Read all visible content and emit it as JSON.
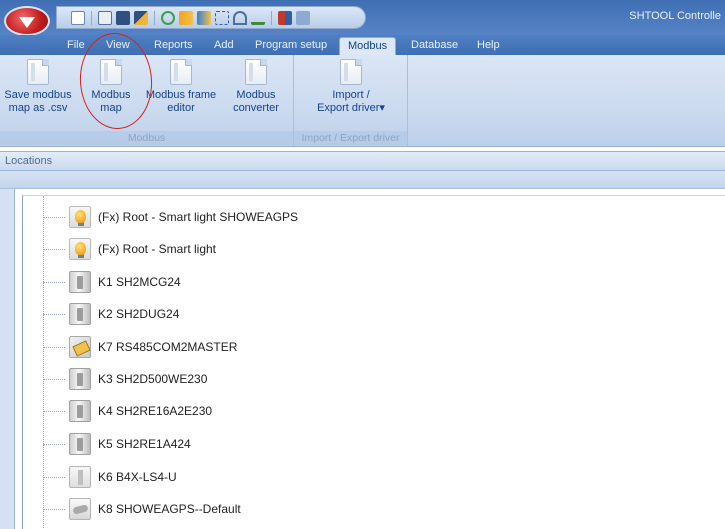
{
  "window": {
    "title": "SHTOOL Controlle"
  },
  "quick_access": {
    "icons": [
      "new-file-icon",
      "open-file-icon",
      "save-icon",
      "edit-icon",
      "refresh-icon",
      "import-icon",
      "export-icon",
      "network-icon",
      "antenna-icon",
      "hierarchy-icon",
      "module-icon",
      "list-icon"
    ]
  },
  "menu": {
    "tabs": [
      {
        "label": "File"
      },
      {
        "label": "View"
      },
      {
        "label": "Reports"
      },
      {
        "label": "Add"
      },
      {
        "label": "Program setup"
      },
      {
        "label": "Modbus",
        "active": true
      },
      {
        "label": "Database"
      },
      {
        "label": "Help"
      }
    ]
  },
  "ribbon": {
    "groups": [
      {
        "label": "Modbus",
        "buttons": [
          {
            "line1": "Save modbus",
            "line2": "map as .csv"
          },
          {
            "line1": "Modbus",
            "line2": "map"
          },
          {
            "line1": "Modbus frame",
            "line2": "editor"
          },
          {
            "line1": "Modbus",
            "line2": "converter"
          }
        ]
      },
      {
        "label": "Import / Export driver",
        "buttons": [
          {
            "line1": "Import /",
            "line2": "Export driver▾"
          }
        ]
      }
    ],
    "highlight_color": "#d42020"
  },
  "locations": {
    "title": "Locations",
    "items": [
      {
        "label": "(Fx) Root - Smart light SHOWEAGPS",
        "icon": "bulb-icon"
      },
      {
        "label": "(Fx) Root - Smart light",
        "icon": "bulb-icon"
      },
      {
        "label": "K1 SH2MCG24",
        "icon": "module-icon"
      },
      {
        "label": "K2 SH2DUG24",
        "icon": "module-icon"
      },
      {
        "label": "K7 RS485COM2MASTER",
        "icon": "com-module-icon"
      },
      {
        "label": "K3 SH2D500WE230",
        "icon": "module-icon"
      },
      {
        "label": "K4 SH2RE16A2E230",
        "icon": "module-icon"
      },
      {
        "label": "K5 SH2RE1A424",
        "icon": "module-icon"
      },
      {
        "label": "K6 B4X-LS4-U",
        "icon": "sensor-icon"
      },
      {
        "label": "K8 SHOWEAGPS--Default",
        "icon": "camera-sensor-icon"
      }
    ]
  },
  "colors": {
    "titlebar": "#3f6fb3",
    "ribbon": "#c8d8ee",
    "ribbon_text": "#15428b"
  }
}
